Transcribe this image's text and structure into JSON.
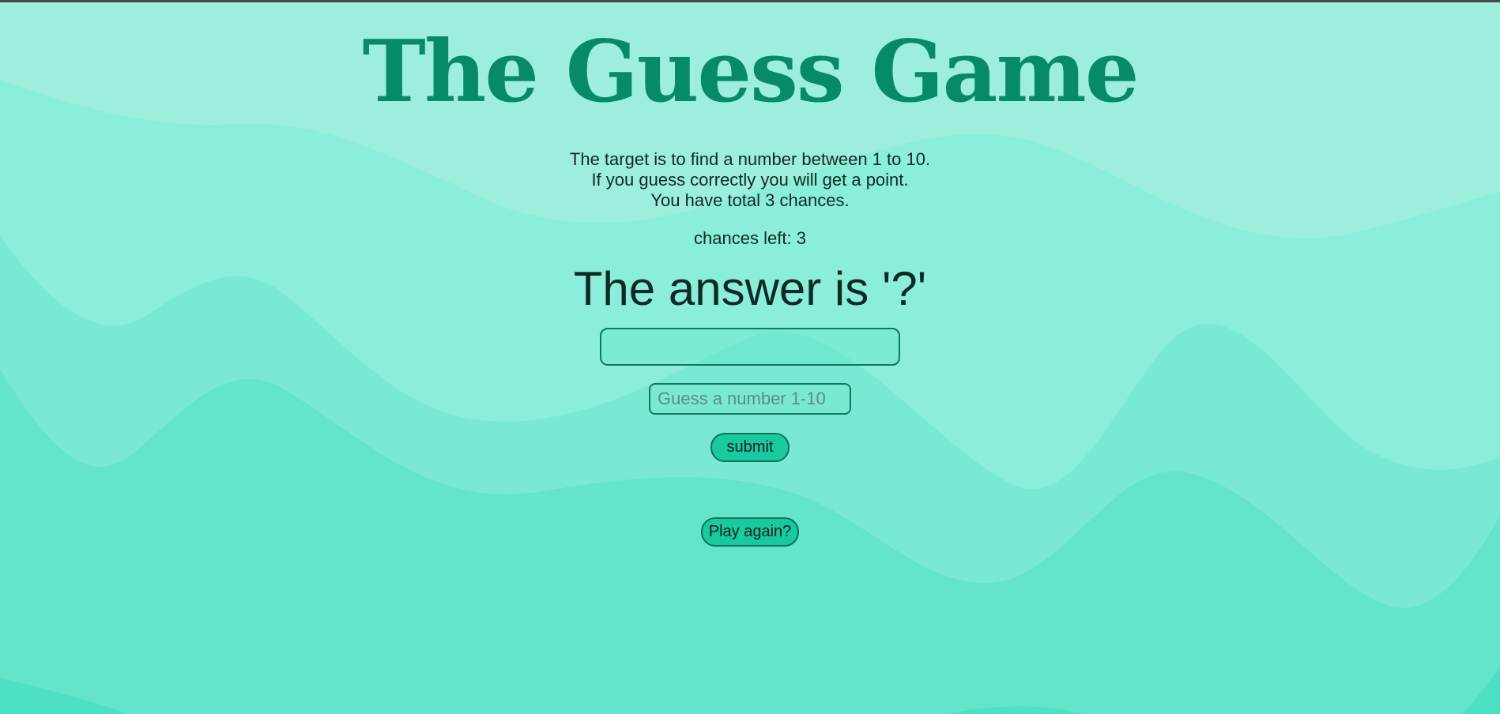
{
  "game": {
    "title": "The Guess Game",
    "rules": [
      "The target is to find a number between 1 to 10.",
      "If you guess correctly you will get a point.",
      "You have total 3 chances."
    ],
    "chances_label": "chances left:",
    "chances_value": "3",
    "answer_prefix": "The answer is ",
    "answer_value": "'?'",
    "answer_box_value": "",
    "guess_input": {
      "value": "",
      "placeholder": "Guess a number 1-10"
    },
    "submit_label": "submit",
    "play_again_label": "Play again?"
  },
  "colors": {
    "title": "#078b67",
    "background_light": "#9eeedd",
    "background_dark": "#4ee0c4",
    "button": "#19c9a0",
    "border": "#11785e"
  }
}
